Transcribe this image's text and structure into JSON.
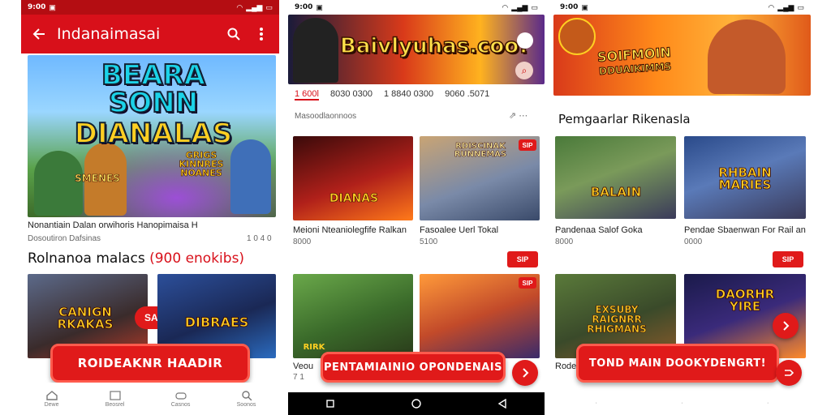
{
  "colors": {
    "brand_red": "#d8101a",
    "cta_red": "#e01a1a"
  },
  "phone1": {
    "status": {
      "time": "9:00"
    },
    "appbar": {
      "title": "Indanaimasai",
      "icons": [
        "back-arrow-icon",
        "search-icon",
        "more-vert-icon"
      ]
    },
    "hero": {
      "logo_line1": "BEARA SONN",
      "logo_line2": "DIANALAS",
      "badge_line1": "GRIGS",
      "badge_line2": "KINNRES",
      "badge_line3": "NOANES",
      "side_label": "SMENES"
    },
    "hero_caption": "Nonantiain Dalan orwihoris Hanopimaisa H",
    "hero_sub": "Dosoutiron Dafsinas",
    "hero_meta": "1 0 4 0",
    "section_title": "Rolnanoa malacs",
    "section_count": "(900 enokibs)",
    "cards": [
      {
        "logo": "CANIGN RKAKAS",
        "tag": "SAIP"
      },
      {
        "logo": "DIBRAES"
      }
    ],
    "cta_label": "ROIDEAKNR HAADIR",
    "nav": [
      "Dewe",
      "Beosrel",
      "Casnos",
      "Soonos"
    ]
  },
  "phone2": {
    "status": {
      "time": "9:00"
    },
    "hero": {
      "logo": "Baivlyuhas.coo!"
    },
    "stats": [
      "1 600l",
      "8030 0300",
      "1 8840 0300",
      "9060 .5071"
    ],
    "stats_caption": "Masoodlaonnoos",
    "cards": [
      {
        "logo": "DIANAS",
        "caption": "Meioni Nteaniolegfife Ralkan",
        "sub": "8000"
      },
      {
        "logo": "RDISCINAK RUNNEMAS",
        "caption": "Fasoalee Uerl Tokal",
        "sub": "5100"
      },
      {
        "logo": "RIRK",
        "caption": "Veou",
        "sub": "7 1"
      },
      {
        "logo": "",
        "caption": "",
        "sub": ""
      }
    ],
    "tag_label": "SIP",
    "cta_label": "PENTAMIAINIO OPONDENAIS"
  },
  "phone3": {
    "status": {
      "time": "9:00"
    },
    "hero": {
      "logo_line1": "SOIFMOIN",
      "logo_line2": "DDUAIKIMMS"
    },
    "section_title": "Pemgaarlar Rikenasla",
    "cards": [
      {
        "logo": "BALAIN",
        "caption": "Pandenaa Salof Goka",
        "sub": "8000"
      },
      {
        "logo": "RHBAIN MARIES",
        "caption": "Pendae Sbaenwan For Rail an",
        "sub": "0000"
      },
      {
        "logo": "EXSUBY RAIGNRR RHIGMANS",
        "caption": "Rode",
        "sub": ""
      },
      {
        "logo": "DAORHR YIRE",
        "caption": "",
        "sub": ""
      }
    ],
    "tag_label": "SIP",
    "cta_label": "TOND MAIN DOOKYDENGRT!"
  }
}
